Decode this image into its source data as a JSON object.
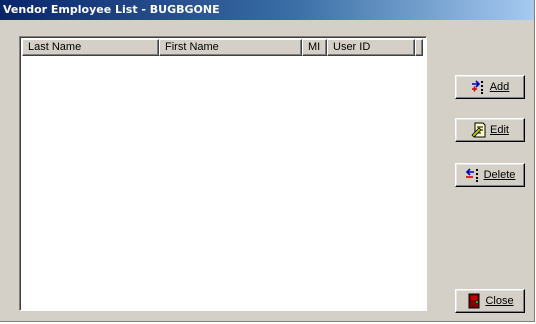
{
  "window": {
    "title": "Vendor Employee List - BUGBGONE"
  },
  "list": {
    "columns": [
      "Last Name",
      "First Name",
      "MI",
      "User ID"
    ],
    "rows": []
  },
  "buttons": {
    "add": "Add",
    "edit": "Edit",
    "delete": "Delete",
    "close": "Close"
  },
  "icons": {
    "add": "add-arrows-icon",
    "edit": "edit-document-icon",
    "delete": "delete-arrows-icon",
    "close": "door-exit-icon"
  }
}
